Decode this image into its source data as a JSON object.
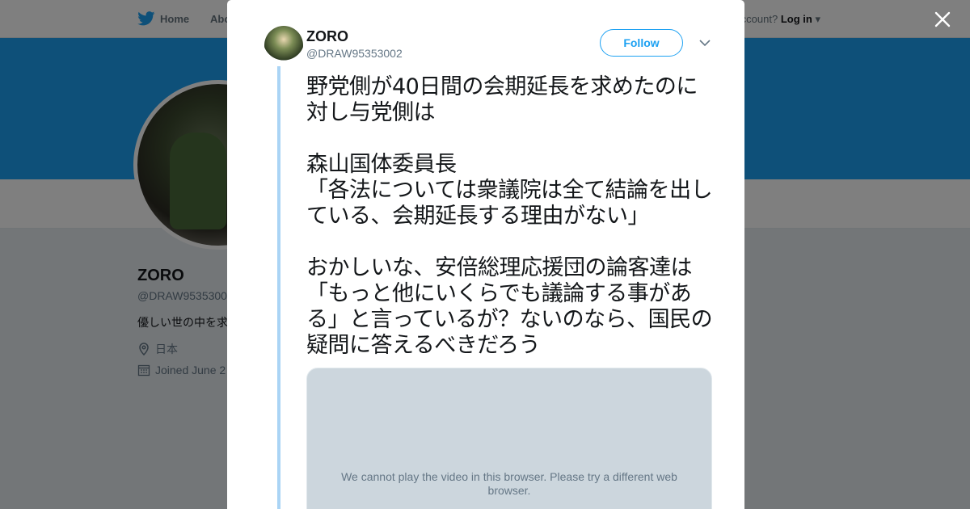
{
  "nav": {
    "home_label": "Home",
    "about_label": "Abo",
    "account_text": "ccount?",
    "login_label": "Log in"
  },
  "profile": {
    "name": "ZORO",
    "handle": "@DRAW9535300",
    "bio": "優しい世の中を求",
    "location": "日本",
    "joined": "Joined June 2"
  },
  "tweet": {
    "author_name": "ZORO",
    "author_handle": "@DRAW95353002",
    "follow_label": "Follow",
    "text": "野党側が40日間の会期延長を求めたのに対し与党側は\n\n森山国体委員長\n「各法については衆議院は全て結論を出している、会期延長する理由がない」\n\nおかしいな、安倍総理応援団の論客達は「もっと他にいくらでも議論する事がある」と言っているが？ないのなら、国民の疑問に答えるべきだろう",
    "video_message": "We cannot play the video in this browser. Please try a different web browser."
  },
  "colors": {
    "accent": "#1da1f2",
    "thread_line": "#aad4f5",
    "overlay": "rgba(0,0,0,0.5)"
  },
  "icons": {
    "logo": "twitter-bird-icon",
    "close": "close-icon",
    "caret": "chevron-down-icon",
    "location": "location-pin-icon",
    "calendar": "calendar-icon"
  }
}
